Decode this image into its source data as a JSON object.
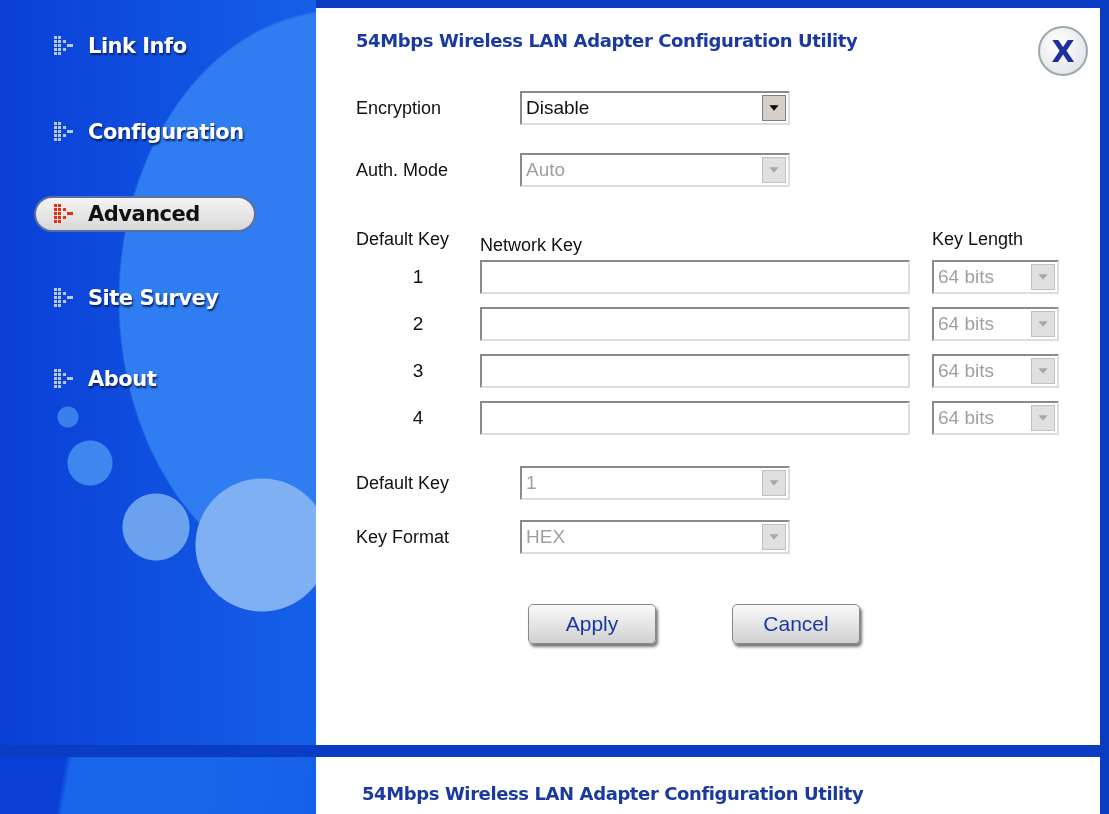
{
  "sidebar": {
    "items": [
      {
        "label": "Link Info",
        "selected": false
      },
      {
        "label": "Configuration",
        "selected": false
      },
      {
        "label": "Advanced",
        "selected": true
      },
      {
        "label": "Site Survey",
        "selected": false
      },
      {
        "label": "About",
        "selected": false
      }
    ]
  },
  "window": {
    "title": "54Mbps Wireless LAN Adapter Configuration Utility",
    "close": "X"
  },
  "top_fields": [
    {
      "label": "Encryption",
      "value": "Disable",
      "disabled": false
    },
    {
      "label": "Auth. Mode",
      "value": "Auto",
      "disabled": true
    }
  ],
  "keys": {
    "default_key_header": "Default Key",
    "network_key_header": "Network Key",
    "key_length_header": "Key Length",
    "rows": [
      {
        "index": "1",
        "length": "64 bits",
        "disabled": true
      },
      {
        "index": "2",
        "length": "64 bits",
        "disabled": true
      },
      {
        "index": "3",
        "length": "64 bits",
        "disabled": true
      },
      {
        "index": "4",
        "length": "64 bits",
        "disabled": true
      }
    ]
  },
  "bottom_fields": [
    {
      "label": "Default Key",
      "value": "1",
      "disabled": true
    },
    {
      "label": "Key Format",
      "value": "HEX",
      "disabled": true
    }
  ],
  "buttons": [
    {
      "label": "Apply"
    },
    {
      "label": "Cancel"
    }
  ],
  "second_window": {
    "title": "54Mbps Wireless LAN Adapter Configuration Utility"
  }
}
